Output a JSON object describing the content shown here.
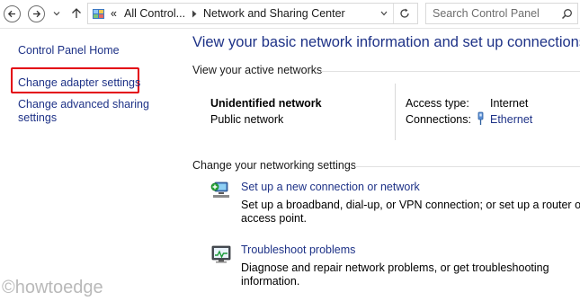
{
  "toolbar": {
    "address_overflow": "«",
    "breadcrumb": [
      "All Control...",
      "Network and Sharing Center"
    ],
    "search_placeholder": "Search Control Panel"
  },
  "sidebar": {
    "items": [
      {
        "label": "Control Panel Home"
      },
      {
        "label": "Change adapter settings",
        "highlighted": true
      },
      {
        "label_lines": [
          "Change advanced sharing",
          "settings"
        ]
      }
    ]
  },
  "main": {
    "title": "View your basic network information and set up connections",
    "active_networks_label": "View your active networks",
    "network": {
      "name": "Unidentified network",
      "type": "Public network",
      "access_type_label": "Access type:",
      "access_type_value": "Internet",
      "connections_label": "Connections:",
      "connections_value": "Ethernet"
    },
    "change_settings_label": "Change your networking settings",
    "tasks": [
      {
        "title": "Set up a new connection or network",
        "desc_lines": [
          "Set up a broadband, dial-up, or VPN connection; or set up a router or",
          "access point."
        ],
        "icon": "network-setup-icon"
      },
      {
        "title": "Troubleshoot problems",
        "desc_lines": [
          "Diagnose and repair network problems, or get troubleshooting",
          "information."
        ],
        "icon": "troubleshoot-icon"
      }
    ]
  },
  "watermark": "©howtoedge",
  "colors": {
    "link": "#1e3287",
    "highlight": "#e3000f",
    "watermark": "#b9b9b9"
  }
}
